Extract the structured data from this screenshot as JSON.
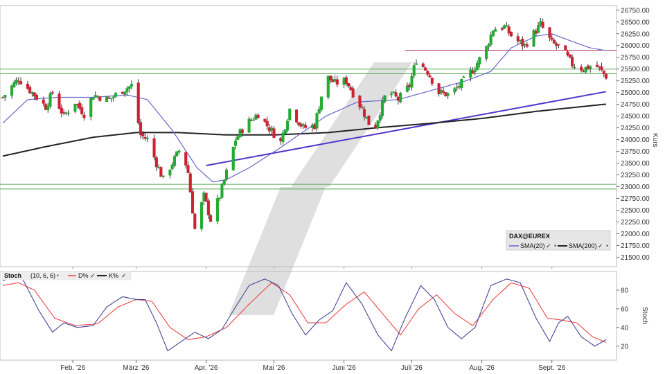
{
  "colors": {
    "up_candle": "#22aa33",
    "down_candle": "#cc2233",
    "sma20": "#6666cc",
    "sma200": "#222222",
    "trendline": "#5533cc",
    "support_lines": "#55aa55",
    "resistance_line": "#bb3355",
    "k_line": "#444499",
    "d_line": "#ee4444",
    "watermark": "#d9d9d9"
  },
  "chart_data": [
    {
      "type": "candlestick",
      "ylabel": "Kurs",
      "ylim": [
        21300,
        26850
      ],
      "y_ticks": [
        "21500.00",
        "21750.00",
        "22000.00",
        "22250.00",
        "22500.00",
        "22750.00",
        "23000.00",
        "23250.00",
        "23500.00",
        "23750.00",
        "24000.00",
        "24250.00",
        "24500.00",
        "24750.00",
        "25000.00",
        "25250.00",
        "25500.00",
        "25750.00",
        "26000.00",
        "26250.00",
        "26500.00",
        "26750.00"
      ],
      "x_ticks": [
        "Feb. '26",
        "März '26",
        "Apr. '26",
        "Mai '26",
        "Juni '26",
        "Juli '26",
        "Aug. '26",
        "Sept. '26"
      ],
      "x_tick_dates": [
        "2026-02-01",
        "2026-03-01",
        "2026-04-01",
        "2026-05-01",
        "2026-06-01",
        "2026-07-01",
        "2026-08-01",
        "2026-09-01"
      ],
      "date_range": [
        "2026-01-01",
        "2026-09-25"
      ],
      "horizontal_lines": [
        {
          "value": 25500,
          "kind": "support"
        },
        {
          "value": 25400,
          "kind": "support"
        },
        {
          "value": 23050,
          "kind": "support"
        },
        {
          "value": 22950,
          "kind": "support"
        },
        {
          "value": 25900,
          "kind": "resistance",
          "from": "2026-06-28"
        }
      ],
      "trendline": {
        "start": [
          "2026-04-01",
          23450
        ],
        "end": [
          "2026-09-25",
          25020
        ]
      },
      "ohlc_anchors": [
        [
          "2026-01-01",
          24900
        ],
        [
          "2026-01-08",
          25300
        ],
        [
          "2026-01-12",
          25100
        ],
        [
          "2026-01-14",
          25000
        ],
        [
          "2026-01-20",
          24700
        ],
        [
          "2026-01-23",
          25000
        ],
        [
          "2026-01-28",
          24500
        ],
        [
          "2026-02-02",
          24800
        ],
        [
          "2026-02-06",
          24550
        ],
        [
          "2026-02-10",
          24950
        ],
        [
          "2026-02-17",
          24850
        ],
        [
          "2026-02-23",
          25050
        ],
        [
          "2026-02-27",
          25150
        ],
        [
          "2026-03-03",
          24100
        ],
        [
          "2026-03-06",
          24000
        ],
        [
          "2026-03-10",
          23500
        ],
        [
          "2026-03-13",
          23150
        ],
        [
          "2026-03-17",
          23500
        ],
        [
          "2026-03-21",
          23850
        ],
        [
          "2026-03-24",
          23300
        ],
        [
          "2026-03-27",
          22100
        ],
        [
          "2026-03-31",
          22800
        ],
        [
          "2026-04-03",
          22300
        ],
        [
          "2026-04-07",
          22800
        ],
        [
          "2026-04-10",
          23300
        ],
        [
          "2026-04-14",
          24000
        ],
        [
          "2026-04-18",
          24300
        ],
        [
          "2026-04-24",
          24550
        ],
        [
          "2026-04-28",
          24300
        ],
        [
          "2026-05-04",
          23950
        ],
        [
          "2026-05-08",
          24650
        ],
        [
          "2026-05-14",
          24250
        ],
        [
          "2026-05-19",
          24300
        ],
        [
          "2026-05-24",
          25350
        ],
        [
          "2026-05-28",
          25200
        ],
        [
          "2026-06-02",
          25250
        ],
        [
          "2026-06-09",
          24650
        ],
        [
          "2026-06-14",
          24150
        ],
        [
          "2026-06-20",
          25050
        ],
        [
          "2026-06-25",
          24850
        ],
        [
          "2026-06-30",
          25150
        ],
        [
          "2026-07-03",
          25700
        ],
        [
          "2026-07-08",
          25450
        ],
        [
          "2026-07-13",
          25000
        ],
        [
          "2026-07-18",
          24950
        ],
        [
          "2026-07-24",
          25250
        ],
        [
          "2026-07-29",
          25550
        ],
        [
          "2026-08-03",
          25950
        ],
        [
          "2026-08-06",
          26350
        ],
        [
          "2026-08-11",
          26400
        ],
        [
          "2026-08-15",
          26150
        ],
        [
          "2026-08-20",
          26000
        ],
        [
          "2026-08-27",
          26450
        ],
        [
          "2026-09-01",
          26050
        ],
        [
          "2026-09-05",
          25950
        ],
        [
          "2026-09-10",
          25600
        ],
        [
          "2026-09-15",
          25500
        ],
        [
          "2026-09-20",
          25600
        ],
        [
          "2026-09-25",
          25350
        ]
      ],
      "sma20_anchors": [
        [
          "2026-01-01",
          24350
        ],
        [
          "2026-01-12",
          24850
        ],
        [
          "2026-01-25",
          24900
        ],
        [
          "2026-02-10",
          24900
        ],
        [
          "2026-02-25",
          24950
        ],
        [
          "2026-03-06",
          24850
        ],
        [
          "2026-03-17",
          24200
        ],
        [
          "2026-03-28",
          23400
        ],
        [
          "2026-04-04",
          23100
        ],
        [
          "2026-04-10",
          23150
        ],
        [
          "2026-04-20",
          23400
        ],
        [
          "2026-05-03",
          23800
        ],
        [
          "2026-05-12",
          24100
        ],
        [
          "2026-05-24",
          24500
        ],
        [
          "2026-06-07",
          24800
        ],
        [
          "2026-06-25",
          24850
        ],
        [
          "2026-07-10",
          25050
        ],
        [
          "2026-07-25",
          25250
        ],
        [
          "2026-08-05",
          25450
        ],
        [
          "2026-08-14",
          25950
        ],
        [
          "2026-08-25",
          26200
        ],
        [
          "2026-09-01",
          26250
        ],
        [
          "2026-09-12",
          26050
        ],
        [
          "2026-09-18",
          25950
        ],
        [
          "2026-09-24",
          25900
        ]
      ],
      "sma200_anchors": [
        [
          "2026-01-01",
          23650
        ],
        [
          "2026-01-20",
          23850
        ],
        [
          "2026-02-10",
          24050
        ],
        [
          "2026-03-01",
          24150
        ],
        [
          "2026-03-20",
          24150
        ],
        [
          "2026-04-10",
          24100
        ],
        [
          "2026-05-01",
          24100
        ],
        [
          "2026-05-25",
          24150
        ],
        [
          "2026-06-15",
          24250
        ],
        [
          "2026-07-10",
          24350
        ],
        [
          "2026-08-01",
          24450
        ],
        [
          "2026-08-25",
          24600
        ],
        [
          "2026-09-24",
          24750
        ]
      ],
      "legend": {
        "instrument": "DAX@EUREX",
        "items": [
          "SMA(20)",
          "SMA(200)"
        ]
      }
    },
    {
      "type": "line",
      "ylabel": "Stoch",
      "ylim": [
        5,
        100
      ],
      "y_ticks": [
        "20",
        "40",
        "60",
        "80"
      ],
      "legend": {
        "indicator": "Stoch",
        "params": "(10, 6, 6)",
        "series_labels": [
          "D%",
          "K%"
        ]
      },
      "series": [
        {
          "name": "K%",
          "anchors": [
            [
              "2026-01-01",
              90
            ],
            [
              "2026-01-06",
              95
            ],
            [
              "2026-01-10",
              91
            ],
            [
              "2026-01-17",
              58
            ],
            [
              "2026-01-23",
              35
            ],
            [
              "2026-01-28",
              45
            ],
            [
              "2026-02-03",
              40
            ],
            [
              "2026-02-10",
              42
            ],
            [
              "2026-02-16",
              62
            ],
            [
              "2026-02-23",
              73
            ],
            [
              "2026-03-01",
              70
            ],
            [
              "2026-03-05",
              70
            ],
            [
              "2026-03-10",
              45
            ],
            [
              "2026-03-15",
              15
            ],
            [
              "2026-03-21",
              25
            ],
            [
              "2026-03-27",
              35
            ],
            [
              "2026-04-02",
              28
            ],
            [
              "2026-04-08",
              38
            ],
            [
              "2026-04-14",
              62
            ],
            [
              "2026-04-20",
              85
            ],
            [
              "2026-04-27",
              92
            ],
            [
              "2026-05-03",
              85
            ],
            [
              "2026-05-09",
              55
            ],
            [
              "2026-05-15",
              32
            ],
            [
              "2026-05-21",
              48
            ],
            [
              "2026-05-27",
              58
            ],
            [
              "2026-06-02",
              88
            ],
            [
              "2026-06-09",
              65
            ],
            [
              "2026-06-16",
              32
            ],
            [
              "2026-06-22",
              15
            ],
            [
              "2026-06-28",
              50
            ],
            [
              "2026-07-05",
              85
            ],
            [
              "2026-07-11",
              70
            ],
            [
              "2026-07-17",
              40
            ],
            [
              "2026-07-23",
              28
            ],
            [
              "2026-07-29",
              40
            ],
            [
              "2026-08-05",
              85
            ],
            [
              "2026-08-12",
              92
            ],
            [
              "2026-08-18",
              88
            ],
            [
              "2026-08-25",
              50
            ],
            [
              "2026-08-31",
              25
            ],
            [
              "2026-09-04",
              45
            ],
            [
              "2026-09-08",
              52
            ],
            [
              "2026-09-14",
              30
            ],
            [
              "2026-09-20",
              20
            ],
            [
              "2026-09-25",
              27
            ]
          ]
        },
        {
          "name": "D%",
          "anchors": [
            [
              "2026-01-01",
              85
            ],
            [
              "2026-01-08",
              88
            ],
            [
              "2026-01-15",
              80
            ],
            [
              "2026-01-24",
              50
            ],
            [
              "2026-02-02",
              42
            ],
            [
              "2026-02-12",
              44
            ],
            [
              "2026-02-21",
              62
            ],
            [
              "2026-03-01",
              70
            ],
            [
              "2026-03-08",
              68
            ],
            [
              "2026-03-16",
              40
            ],
            [
              "2026-03-24",
              27
            ],
            [
              "2026-04-01",
              30
            ],
            [
              "2026-04-10",
              40
            ],
            [
              "2026-04-20",
              65
            ],
            [
              "2026-04-30",
              88
            ],
            [
              "2026-05-08",
              75
            ],
            [
              "2026-05-16",
              45
            ],
            [
              "2026-05-24",
              45
            ],
            [
              "2026-06-02",
              65
            ],
            [
              "2026-06-10",
              78
            ],
            [
              "2026-06-18",
              55
            ],
            [
              "2026-06-26",
              32
            ],
            [
              "2026-07-04",
              60
            ],
            [
              "2026-07-12",
              75
            ],
            [
              "2026-07-20",
              55
            ],
            [
              "2026-07-28",
              42
            ],
            [
              "2026-08-06",
              70
            ],
            [
              "2026-08-14",
              88
            ],
            [
              "2026-08-22",
              82
            ],
            [
              "2026-08-30",
              50
            ],
            [
              "2026-09-05",
              48
            ],
            [
              "2026-09-12",
              45
            ],
            [
              "2026-09-19",
              30
            ],
            [
              "2026-09-25",
              24
            ]
          ]
        }
      ]
    }
  ]
}
